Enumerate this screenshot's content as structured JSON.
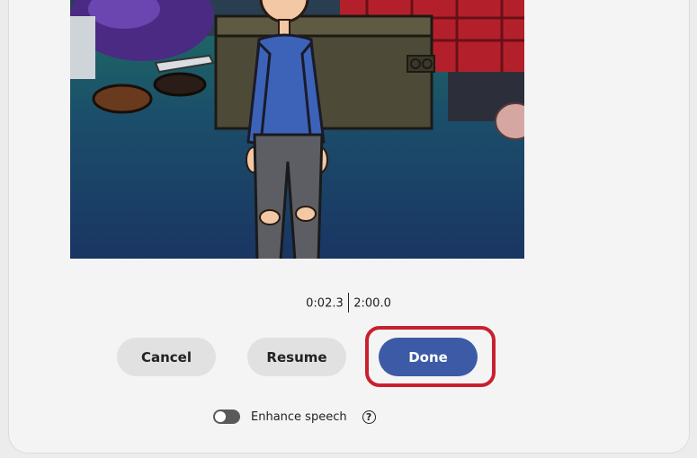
{
  "preview": {
    "image_name": "cartoon-character-in-bedroom"
  },
  "recording": {
    "elapsed": "0:02.3",
    "limit": "2:00.0"
  },
  "actions": {
    "cancel_label": "Cancel",
    "resume_label": "Resume",
    "done_label": "Done"
  },
  "enhance": {
    "label": "Enhance speech",
    "enabled": false,
    "help_glyph": "?"
  },
  "colors": {
    "primary_button": "#3d5aa6",
    "secondary_button": "#e1e1e1",
    "highlight": "#c8202f"
  },
  "icons": {
    "toggle": "toggle-switch-icon",
    "help": "question-circle-icon"
  }
}
